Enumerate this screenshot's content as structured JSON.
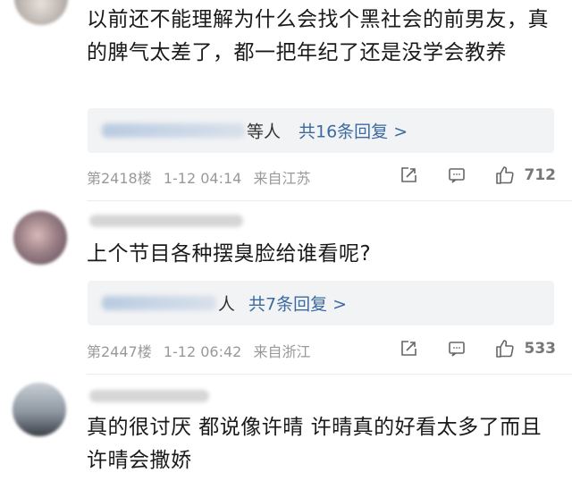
{
  "comments": [
    {
      "content": "以前还不能理解为什么会找个黑社会的前男友，真的脾气太差了，都一把年纪了还是没学会教养",
      "reply_suffix": "等人",
      "reply_count": "共16条回复 >",
      "floor": "第2418楼",
      "time": "1-12 04:14",
      "location": "来自江苏",
      "likes": "712"
    },
    {
      "content": "上个节目各种摆臭脸给谁看呢?",
      "reply_suffix": "人",
      "reply_count": "共7条回复 >",
      "floor": "第2447楼",
      "time": "1-12 06:42",
      "location": "来自浙江",
      "likes": "533"
    },
    {
      "content": "真的很讨厌 都说像许晴 许晴真的好看太多了而且许晴会撒娇"
    }
  ],
  "icons": {
    "share": "share-icon",
    "reply": "comment-icon",
    "like": "thumbs-up-icon"
  },
  "colors": {
    "link": "#3b6aa0",
    "meta": "#999999",
    "reply_bg": "#f2f3f5"
  }
}
